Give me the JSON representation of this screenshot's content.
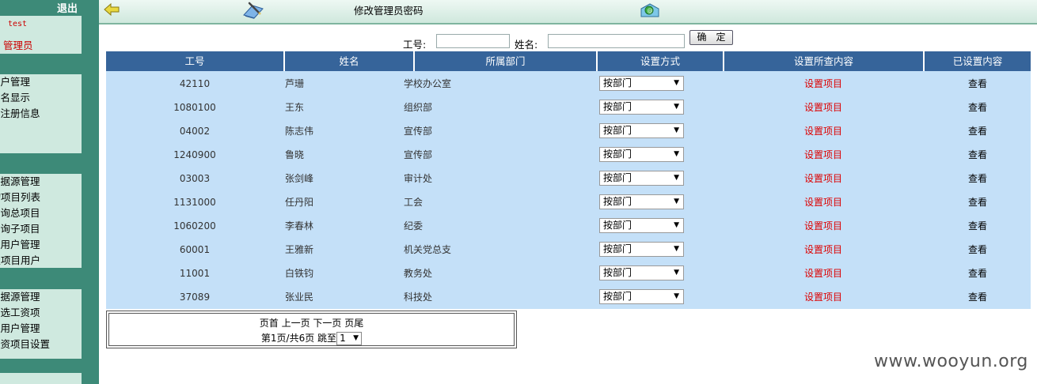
{
  "sidebar": {
    "logout_label": "退出",
    "user": {
      "username": "test",
      "role": "管理员"
    },
    "group1": [
      "用户管理",
      "匿名显示",
      "新注册信息"
    ],
    "group2": [
      "数据源管理",
      "查询项目列表",
      "查询总项目",
      "查询子项目",
      "总用户管理",
      "设置项目用户"
    ],
    "group3": [
      "数据源管理",
      "筛选工资项",
      "总用户管理",
      "工资项目设置"
    ]
  },
  "topbar": {
    "title": "修改管理员密码",
    "back_icon": "arrow-left-icon",
    "edit_icon": "edit-book-icon",
    "mail_icon": "mail-icon"
  },
  "search": {
    "id_label": "工号:",
    "name_label": "姓名:",
    "id_value": "",
    "name_value": "",
    "submit_label": "确　定"
  },
  "table": {
    "headers": [
      "工号",
      "姓名",
      "所属部门",
      "设置方式",
      "设置所查内容",
      "已设置内容"
    ],
    "rows": [
      {
        "id": "42110",
        "name": "芦珊",
        "dept": "学校办公室",
        "mode": "按部门",
        "action": "设置项目",
        "view": "查看"
      },
      {
        "id": "1080100",
        "name": "王东",
        "dept": "组织部",
        "mode": "按部门",
        "action": "设置项目",
        "view": "查看"
      },
      {
        "id": "04002",
        "name": "陈志伟",
        "dept": "宣传部",
        "mode": "按部门",
        "action": "设置项目",
        "view": "查看"
      },
      {
        "id": "1240900",
        "name": "鲁晓",
        "dept": "宣传部",
        "mode": "按部门",
        "action": "设置项目",
        "view": "查看"
      },
      {
        "id": "03003",
        "name": "张剑峰",
        "dept": "审计处",
        "mode": "按部门",
        "action": "设置项目",
        "view": "查看"
      },
      {
        "id": "1131000",
        "name": "任丹阳",
        "dept": "工会",
        "mode": "按部门",
        "action": "设置项目",
        "view": "查看"
      },
      {
        "id": "1060200",
        "name": "李春林",
        "dept": "纪委",
        "mode": "按部门",
        "action": "设置项目",
        "view": "查看"
      },
      {
        "id": "60001",
        "name": "王雅新",
        "dept": "机关党总支",
        "mode": "按部门",
        "action": "设置项目",
        "view": "查看"
      },
      {
        "id": "11001",
        "name": "白铁钧",
        "dept": "教务处",
        "mode": "按部门",
        "action": "设置项目",
        "view": "查看"
      },
      {
        "id": "37089",
        "name": "张业民",
        "dept": "科技处",
        "mode": "按部门",
        "action": "设置项目",
        "view": "查看"
      }
    ]
  },
  "pager": {
    "first": "页首",
    "prev": "上一页",
    "next": "下一页",
    "last": "页尾",
    "page_info": "第1页/共6页 跳至",
    "selected_page": "1"
  },
  "watermark": "www.wooyun.org",
  "colors": {
    "header_bg": "#36649a",
    "row_bg": "#c4e0f8",
    "sidebar_bg": "#3d8a78",
    "link_red": "#dd0000"
  }
}
